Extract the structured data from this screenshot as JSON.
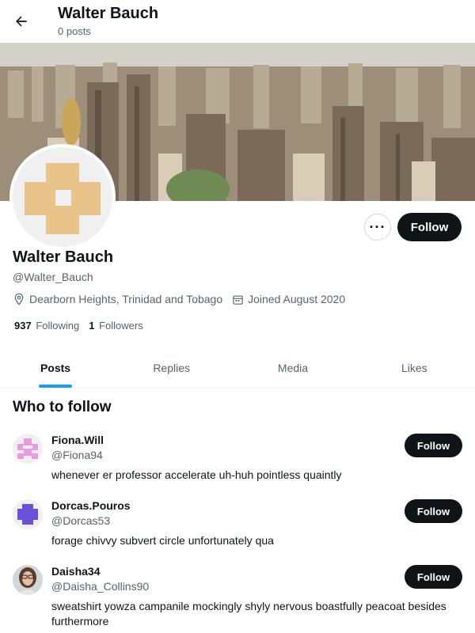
{
  "header": {
    "name": "Walter Bauch",
    "post_count": "0 posts",
    "back_icon": "arrow-left-icon"
  },
  "profile": {
    "name": "Walter Bauch",
    "handle": "@Walter_Bauch",
    "location": "Dearborn Heights, Trinidad and Tobago",
    "joined": "Joined August 2020",
    "following_count": "937",
    "following_label": "Following",
    "followers_count": "1",
    "followers_label": "Followers",
    "follow_label": "Follow",
    "more_label": "···",
    "avatar_color": "#e8c48a"
  },
  "tabs": [
    {
      "label": "Posts",
      "active": true
    },
    {
      "label": "Replies",
      "active": false
    },
    {
      "label": "Media",
      "active": false
    },
    {
      "label": "Likes",
      "active": false
    }
  ],
  "who_to_follow": {
    "title": "Who to follow",
    "follow_label": "Follow",
    "users": [
      {
        "name": "Fiona.Will",
        "handle": "@Fiona94",
        "bio": "whenever er professor accelerate uh-huh pointless quaintly",
        "avatar_color": "#e89be0"
      },
      {
        "name": "Dorcas.Pouros",
        "handle": "@Dorcas53",
        "bio": "forage chivvy subvert circle unfortunately qua",
        "avatar_color": "#6b4fd8"
      },
      {
        "name": "Daisha34",
        "handle": "@Daisha_Collins90",
        "bio": "sweatshirt yowza campanile mockingly shyly nervous boastfully peacoat besides furthermore",
        "avatar_color": "#b08c6e"
      }
    ]
  },
  "colors": {
    "accent": "#1d9bf0",
    "text": "#0f1419",
    "muted": "#536471",
    "button_dark": "#0f1419"
  }
}
